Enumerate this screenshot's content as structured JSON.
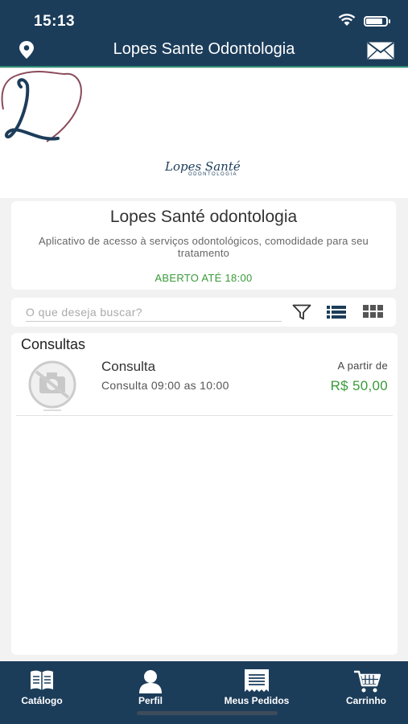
{
  "status_bar": {
    "time": "15:13"
  },
  "nav": {
    "title": "Lopes Sante Odontologia",
    "left_icon": "map-pin-icon",
    "right_icon": "envelope-icon"
  },
  "banner": {
    "logo_letter": "L",
    "brand": "Lopes Santé",
    "brand_sub": "ODONTOLOGIA"
  },
  "store": {
    "name": "Lopes Santé odontologia",
    "description": "Aplicativo de acesso à serviços odontológicos, comodidade para seu tratamento",
    "hours": "ABERTO ATÉ 18:00"
  },
  "search": {
    "placeholder": "O que deseja buscar?",
    "value": ""
  },
  "catalog": {
    "category": "Consultas",
    "items": [
      {
        "name": "Consulta",
        "description": "Consulta 09:00 as 10:00",
        "price_prefix": "A partir de",
        "price": "R$ 50,00",
        "image": "no-photo-icon"
      }
    ]
  },
  "tabs": [
    {
      "label": "Catálogo",
      "icon": "book-icon"
    },
    {
      "label": "Perfil",
      "icon": "user-icon"
    },
    {
      "label": "Meus Pedidos",
      "icon": "receipt-icon"
    },
    {
      "label": "Carrinho",
      "icon": "cart-icon"
    }
  ],
  "colors": {
    "primary": "#1c3d5a",
    "accent_green": "#3a9a3a",
    "divider_teal": "#2e8c74",
    "background": "#f2f2f2"
  }
}
